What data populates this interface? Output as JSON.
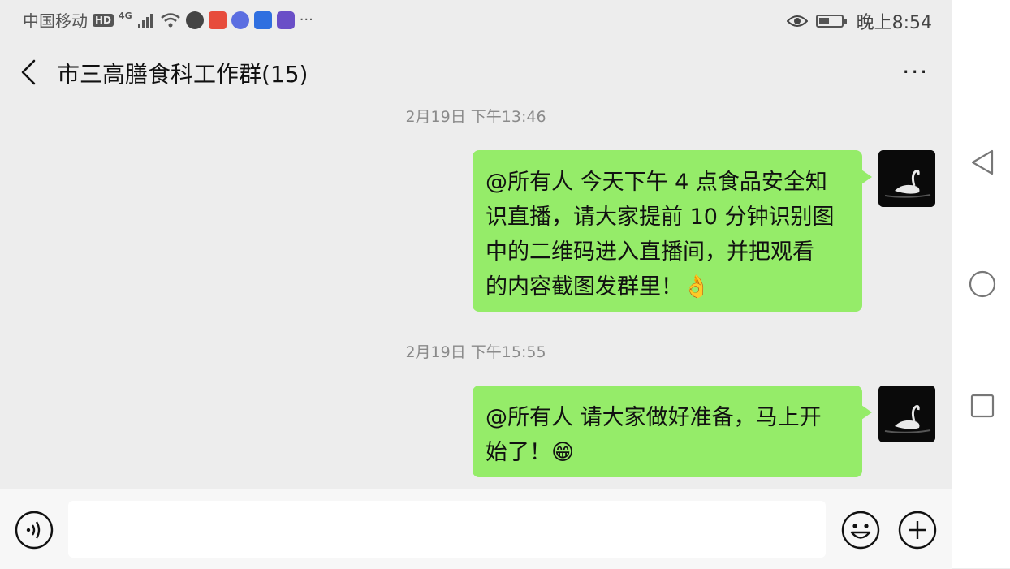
{
  "status_bar": {
    "carrier": "中国移动",
    "hd": "HD",
    "network": "4G",
    "time": "晚上8:54",
    "more": "···"
  },
  "header": {
    "title": "市三高膳食科工作群(15)",
    "menu": "···"
  },
  "messages": [
    {
      "timestamp": "2月19日 下午13:46",
      "lines": [
        "@所有人  今天下午 4 点食品安全知",
        "识直播，请大家提前 10 分钟识别图",
        "中的二维码进入直播间，并把观看",
        "的内容截图发群里！👌"
      ]
    },
    {
      "timestamp": "2月19日 下午15:55",
      "lines": [
        "@所有人  请大家做好准备，马上开",
        "始了！😁"
      ]
    }
  ],
  "input": {
    "value": ""
  },
  "icons": {
    "back": "back-arrow-icon",
    "voice": "voice-icon",
    "emoji": "emoji-icon",
    "plus": "plus-icon"
  },
  "colors": {
    "bubble": "#95ec69",
    "background": "#ededed"
  }
}
